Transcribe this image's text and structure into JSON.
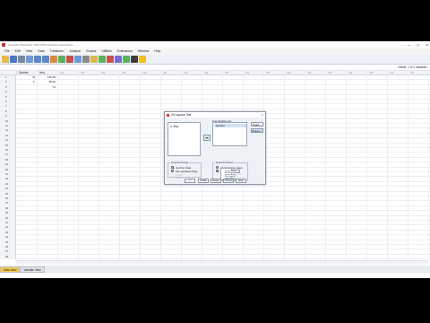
{
  "window": {
    "title": "Untitled1 [DataSet0] - IBM SPSS Statistics Data Editor",
    "controls": [
      "–",
      "□",
      "×"
    ]
  },
  "menu": [
    "File",
    "Edit",
    "View",
    "Data",
    "Transform",
    "Analyze",
    "Graphs",
    "Utilities",
    "Extensions",
    "Window",
    "Help"
  ],
  "toolbar": {
    "buttons": [
      {
        "name": "open-icon",
        "color": "#e8b84a"
      },
      {
        "name": "save-icon",
        "color": "#4a78c2"
      },
      {
        "name": "print-icon",
        "color": "#7a8aa0"
      },
      {
        "name": "recall-dialog-icon",
        "color": "#6f9ad8"
      },
      {
        "name": "undo-icon",
        "color": "#5d88c9"
      },
      {
        "name": "redo-icon",
        "color": "#5d88c9"
      },
      {
        "name": "goto-case-icon",
        "color": "#d88a3c"
      },
      {
        "name": "goto-variable-icon",
        "color": "#5bb05b"
      },
      {
        "name": "variables-icon",
        "color": "#c84f4f"
      },
      {
        "name": "run-descriptives-icon",
        "color": "#6f9ad8"
      },
      {
        "name": "find-icon",
        "color": "#8a8a8a"
      },
      {
        "name": "insert-cases-icon",
        "color": "#d8b84a"
      },
      {
        "name": "insert-variable-icon",
        "color": "#5bb05b"
      },
      {
        "name": "split-file-icon",
        "color": "#c84f4f"
      },
      {
        "name": "weight-cases-icon",
        "color": "#7a6ad8"
      },
      {
        "name": "select-cases-icon",
        "color": "#5bb05b"
      },
      {
        "name": "value-labels-icon",
        "color": "#3e3e3e"
      },
      {
        "name": "use-sets-icon",
        "color": "#f0c020"
      }
    ]
  },
  "varinfo": "Visible: 2 of 2 Variables",
  "grid": {
    "columns": [
      "Gender",
      "freq",
      "var",
      "var",
      "var",
      "var",
      "var",
      "var",
      "var",
      "var",
      "var",
      "var",
      "var",
      "var",
      "var",
      "var",
      "var",
      "var",
      "var",
      "var"
    ],
    "rows": [
      [
        "1",
        "M",
        "135.00"
      ],
      [
        "2",
        "F",
        "98.00"
      ],
      [
        "3",
        "",
        "72"
      ],
      [
        "4",
        "",
        ""
      ],
      [
        "5",
        "",
        ""
      ],
      [
        "6",
        "",
        ""
      ],
      [
        "7",
        "",
        ""
      ],
      [
        "8",
        "",
        ""
      ],
      [
        "9",
        "",
        ""
      ],
      [
        "10",
        "",
        ""
      ],
      [
        "11",
        "",
        ""
      ],
      [
        "12",
        "",
        ""
      ],
      [
        "13",
        "",
        ""
      ],
      [
        "14",
        "",
        ""
      ],
      [
        "15",
        "",
        ""
      ],
      [
        "16",
        "",
        ""
      ],
      [
        "17",
        "",
        ""
      ],
      [
        "18",
        "",
        ""
      ],
      [
        "19",
        "",
        ""
      ],
      [
        "20",
        "",
        ""
      ],
      [
        "21",
        "",
        ""
      ],
      [
        "22",
        "",
        ""
      ],
      [
        "23",
        "",
        ""
      ],
      [
        "24",
        "",
        ""
      ],
      [
        "25",
        "",
        ""
      ],
      [
        "26",
        "",
        ""
      ],
      [
        "27",
        "",
        ""
      ],
      [
        "28",
        "",
        ""
      ],
      [
        "29",
        "",
        ""
      ],
      [
        "30",
        "",
        ""
      ],
      [
        "31",
        "",
        ""
      ],
      [
        "32",
        "",
        ""
      ],
      [
        "33",
        "",
        ""
      ],
      [
        "34",
        "",
        ""
      ],
      [
        "35",
        "",
        ""
      ],
      [
        "36",
        "",
        ""
      ],
      [
        "37",
        "",
        ""
      ],
      [
        "38",
        "",
        ""
      ]
    ]
  },
  "tabs": [
    "Data View",
    "Variable View"
  ],
  "dialog": {
    "title": "Chi-square Test",
    "close": "×",
    "source_items": [
      "freq"
    ],
    "transfer_arrow": "➡",
    "test_list_label": "Test Variable List:",
    "test_items": [
      "Gender"
    ],
    "side_buttons": [
      "Exact...",
      "Options..."
    ],
    "expected_range": {
      "title": "Expected Range",
      "options": [
        "Get from data",
        "Use specified range"
      ],
      "lower_label": "Lower:",
      "upper_label": "Upper:"
    },
    "expected_values": {
      "title": "Expected Values",
      "options": [
        "All categories equal",
        "Values:"
      ],
      "values": [
        "",
        "",
        "",
        ""
      ]
    },
    "buttons": [
      "OK",
      "Paste",
      "Reset",
      "Cancel",
      "Help"
    ]
  }
}
